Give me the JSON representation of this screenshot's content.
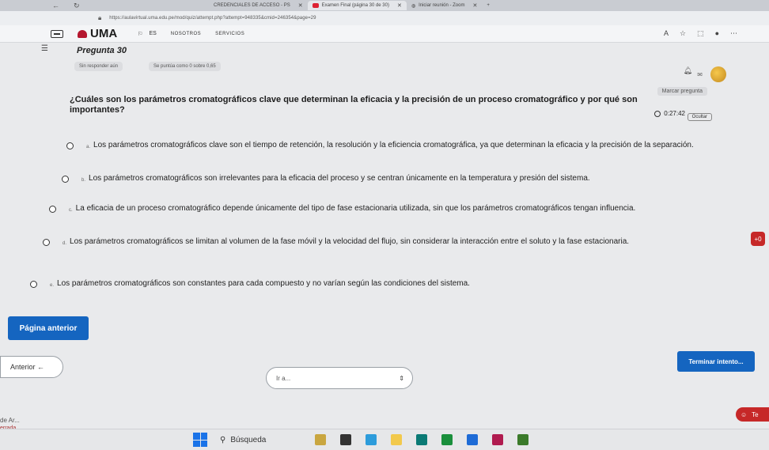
{
  "browser": {
    "tabs": [
      {
        "label": "CREDENCIALES DE ACCESO - PS"
      },
      {
        "label": "Examen Final (página 30 de 30)"
      },
      {
        "label": "Iniciar reunión - Zoom"
      }
    ],
    "url": "https://aulavirtual.uma.edu.pe/mod/quiz/attempt.php?attempt=948335&cmid=246354&page=29"
  },
  "header": {
    "brand": "UMA",
    "lang": "ES",
    "nav": [
      "NOSOTROS",
      "SERVICIOS"
    ]
  },
  "quiz": {
    "question_number": "Pregunta 30",
    "status": "Sin responder aún",
    "grade": "Se puntúa como 0 sobre 0,65",
    "flag_label": "Marcar pregunta",
    "timer": "0:27:42",
    "hide_label": "Ocultar",
    "question_text": "¿Cuáles son los parámetros cromatográficos clave que determinan la eficacia y la precisión de un proceso cromatográfico y por qué son importantes?",
    "answers": [
      {
        "letter": "a.",
        "text": "Los parámetros cromatográficos clave son el tiempo de retención, la resolución y la eficiencia cromatográfica, ya que determinan la eficacia y la precisión de la separación."
      },
      {
        "letter": "b.",
        "text": "Los parámetros cromatográficos son irrelevantes para la eficacia del proceso y se centran únicamente en la temperatura y presión del sistema."
      },
      {
        "letter": "c.",
        "text": "La eficacia de un proceso cromatográfico depende únicamente del tipo de fase estacionaria utilizada, sin que los parámetros cromatográficos tengan influencia."
      },
      {
        "letter": "d.",
        "text": "Los parámetros cromatográficos se limitan al volumen de la fase móvil y la velocidad del flujo, sin considerar la interacción entre el soluto y la fase estacionaria."
      },
      {
        "letter": "e.",
        "text": "Los parámetros cromatográficos son constantes para cada compuesto y no varían según las condiciones del sistema."
      }
    ],
    "prev_page_label": "Página anterior",
    "finish_label": "Terminar intento...",
    "anterior_label": "Anterior ←",
    "goto_placeholder": "Ir a...",
    "float_badge": "+0"
  },
  "bottom_left": {
    "line1": "de Ar...",
    "line2": "errada"
  },
  "taskbar": {
    "search_label": "Búsqueda"
  },
  "colors": {
    "primary": "#1565c0",
    "accent_red": "#c62828"
  }
}
